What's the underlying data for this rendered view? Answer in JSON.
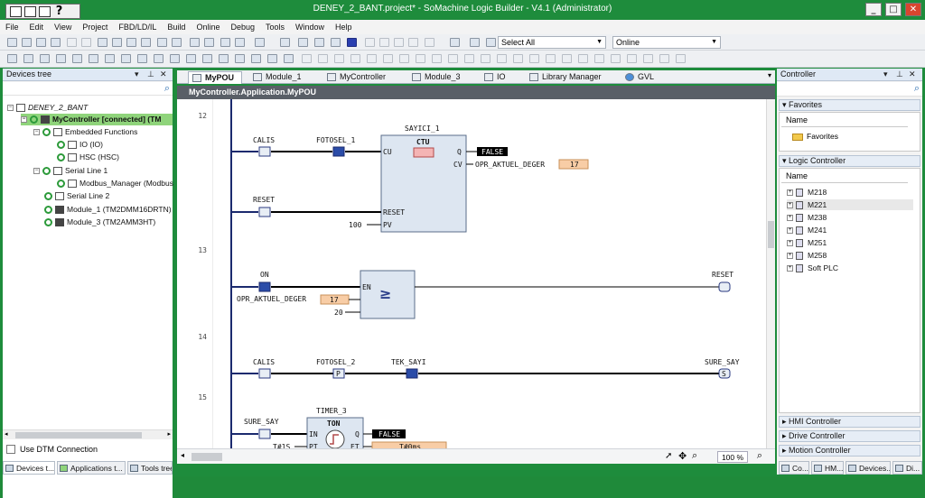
{
  "window": {
    "title": "DENEY_2_BANT.project* - SoMachine Logic Builder - V4.1 (Administrator)",
    "minimize": "_",
    "maximize": "□",
    "close": "✕"
  },
  "quick_access": {
    "help": "?"
  },
  "menu": [
    "File",
    "Edit",
    "View",
    "Project",
    "FBD/LD/IL",
    "Build",
    "Online",
    "Debug",
    "Tools",
    "Window",
    "Help"
  ],
  "toolbar": {
    "select_all": "Select All",
    "online_mode": "Online"
  },
  "devices_tree": {
    "title": "Devices tree",
    "items": [
      {
        "label": "DENEY_2_BANT",
        "icon": "project-icon",
        "level": 0
      },
      {
        "label": "MyController [connected] (TM",
        "icon": "controller-icon",
        "level": 1
      },
      {
        "label": "Embedded Functions",
        "icon": "folder-icon",
        "level": 2
      },
      {
        "label": "IO (IO)",
        "icon": "io-icon",
        "level": 3
      },
      {
        "label": "HSC (HSC)",
        "icon": "hsc-icon",
        "level": 3
      },
      {
        "label": "Serial Line 1",
        "icon": "serial-icon",
        "level": 2
      },
      {
        "label": "Modbus_Manager (Modbus",
        "icon": "modbus-icon",
        "level": 3
      },
      {
        "label": "Serial Line 2",
        "icon": "serial-icon",
        "level": 2
      },
      {
        "label": "Module_1 (TM2DMM16DRTN)",
        "icon": "module-icon",
        "level": 2
      },
      {
        "label": "Module_3 (TM2AMM3HT)",
        "icon": "module-icon",
        "level": 2
      }
    ],
    "use_dtm": "Use DTM Connection"
  },
  "editor_tabs": [
    "MyPOU",
    "Module_1",
    "MyController",
    "Module_3",
    "IO",
    "Library Manager",
    "GVL"
  ],
  "editor_path": "MyController.Application.MyPOU",
  "ladder": {
    "line_numbers": [
      "12",
      "13",
      "14",
      "15"
    ],
    "rung12": {
      "calis": "CALIS",
      "fotosel": "FOTOSEL_1",
      "fb_instance": "SAYICI_1",
      "fb_type": "CTU",
      "cu": "CU",
      "q": "Q",
      "cv": "CV",
      "reset_pin": "RESET",
      "pv": "PV",
      "q_value": "FALSE",
      "cv_var": "OPR_AKTUEL_DEGER",
      "cv_value": "17",
      "reset_contact": "RESET",
      "pv_value": "100"
    },
    "rung13": {
      "on": "ON",
      "ge": "GE",
      "ge_symbol": "≥",
      "en": "EN",
      "in1_var": "OPR_AKTUEL_DEGER",
      "in1_value": "17",
      "in2_value": "20",
      "coil": "RESET"
    },
    "rung14": {
      "calis": "CALIS",
      "fotosel": "FOTOSEL_2",
      "tek_sayi": "TEK_SAYI",
      "p": "P",
      "coil": "SURE_SAY",
      "coil_type": "S"
    },
    "rung15": {
      "contact": "SURE_SAY",
      "fb_instance": "TIMER_3",
      "fb_type": "TON",
      "in": "IN",
      "pt": "PT",
      "q": "Q",
      "et": "ET",
      "pt_value": "T#1S",
      "q_value": "FALSE",
      "et_value": "T#0ms"
    }
  },
  "zoom": "100 %",
  "controller_pane": {
    "title": "Controller",
    "favorites_header": "Favorites",
    "name_col": "Name",
    "favorites_folder": "Favorites",
    "logic_header": "Logic Controller",
    "logic_items": [
      "M218",
      "M221",
      "M238",
      "M241",
      "M251",
      "M258",
      "Soft PLC"
    ],
    "hmi": "HMI Controller",
    "drive": "Drive Controller",
    "motion": "Motion Controller"
  },
  "bottom_tabs": [
    "Devices t...",
    "Applications t...",
    "Tools tree",
    "Co...",
    "HM...",
    "Devices...",
    "Di..."
  ],
  "colors": {
    "title_bg": "#1e8c3c",
    "selected_row": "#8fd47b",
    "value_bg": "#f8cda6",
    "false_bg": "#000000"
  }
}
